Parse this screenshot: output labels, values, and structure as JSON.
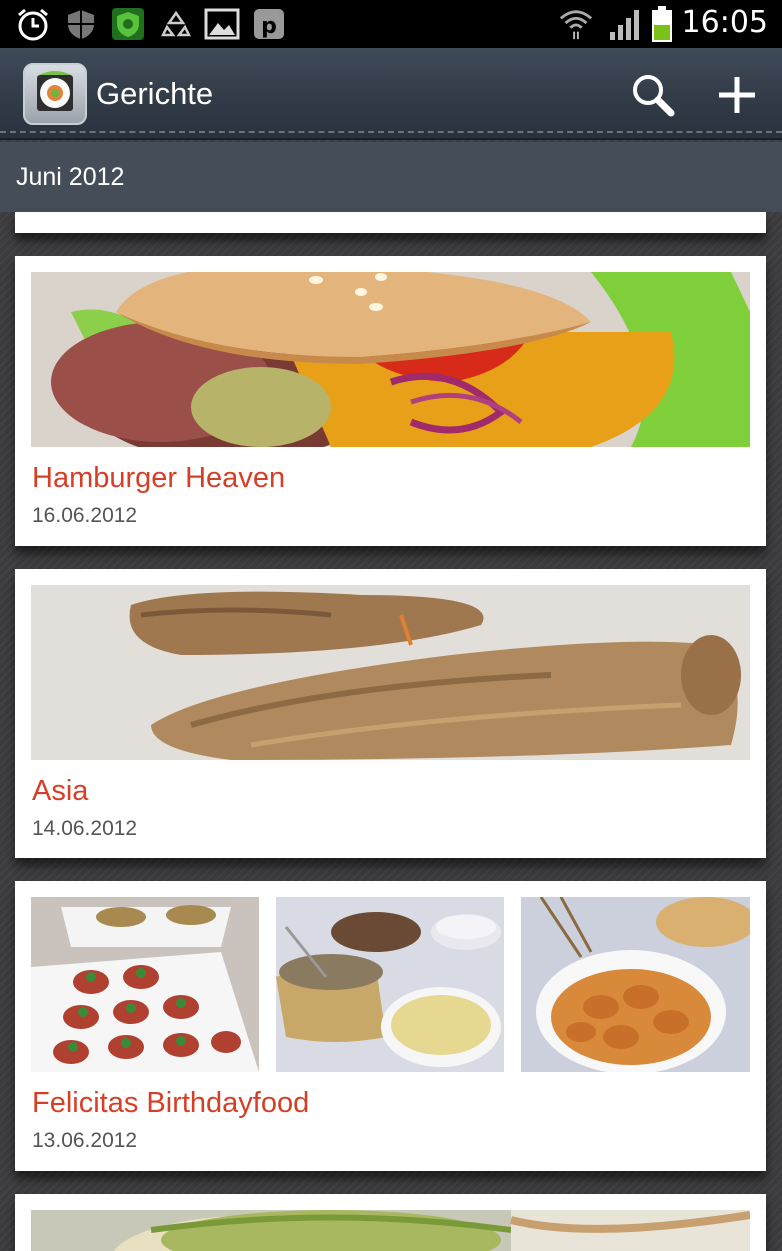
{
  "status_bar": {
    "time": "16:05",
    "icons": [
      "alarm-icon",
      "shield-icon",
      "security-shield-icon",
      "recycle-icon",
      "gallery-icon",
      "parking-icon",
      "wifi-icon",
      "signal-icon",
      "battery-icon"
    ]
  },
  "action_bar": {
    "title": "Gerichte",
    "app_icon": "sushi-app-icon",
    "actions": [
      "search-icon",
      "add-icon"
    ]
  },
  "section": {
    "label": "Juni 2012"
  },
  "dishes": [
    {
      "title": "Hamburger Heaven",
      "date": "16.06.2012",
      "photos": [
        "burger-photo"
      ]
    },
    {
      "title": "Asia",
      "date": "14.06.2012",
      "photos": [
        "spring-roll-photo"
      ]
    },
    {
      "title": "Felicitas Birthdayfood",
      "date": "13.06.2012",
      "photos": [
        "bruschetta-photo",
        "salad-bowls-photo",
        "chips-bowl-photo"
      ]
    }
  ],
  "colors": {
    "title_accent": "#d63f26",
    "action_bar": "#333c48",
    "background": "#3c3c3e"
  }
}
